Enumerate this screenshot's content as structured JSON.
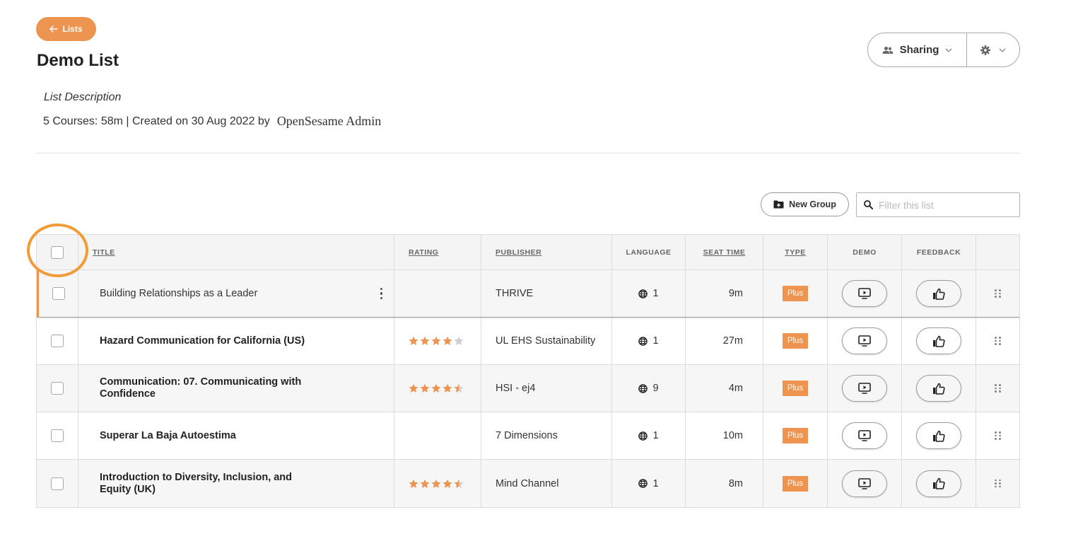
{
  "back_button": {
    "label": "Lists",
    "icon": "arrow-left-icon"
  },
  "page_title": "Demo List",
  "sharing": {
    "label": "Sharing",
    "icon": "people-icon",
    "settings_icon": "gear-icon"
  },
  "description": "List Description",
  "meta": {
    "summary": "5 Courses: 58m | Created on 30 Aug 2022 by",
    "author": "OpenSesame Admin"
  },
  "toolbar": {
    "new_group_label": "New Group",
    "filter_placeholder": "Filter this list",
    "filter_value": ""
  },
  "table": {
    "headers": {
      "title": "TITLE",
      "rating": "RATING",
      "publisher": "PUBLISHER",
      "language": "LANGUAGE",
      "seat_time": "SEAT TIME",
      "type": "TYPE",
      "demo": "DEMO",
      "feedback": "FEEDBACK"
    },
    "rows": [
      {
        "title": "Building Relationships as a Leader",
        "rating": null,
        "publisher": "THRIVE",
        "languages": "1",
        "seat_time": "9m",
        "type": "Plus"
      },
      {
        "title": "Hazard Communication for California (US)",
        "rating": 4,
        "publisher": "UL EHS Sustainability",
        "languages": "1",
        "seat_time": "27m",
        "type": "Plus"
      },
      {
        "title": "Communication: 07. Communicating with Confidence",
        "rating": 4.5,
        "publisher": "HSI - ej4",
        "languages": "9",
        "seat_time": "4m",
        "type": "Plus"
      },
      {
        "title": "Superar La Baja Autoestima",
        "rating": null,
        "publisher": "7 Dimensions",
        "languages": "1",
        "seat_time": "10m",
        "type": "Plus"
      },
      {
        "title": "Introduction to Diversity, Inclusion, and Equity (UK)",
        "rating": 4.5,
        "publisher": "Mind Channel",
        "languages": "1",
        "seat_time": "8m",
        "type": "Plus"
      }
    ]
  },
  "colors": {
    "accent": "#ec9450",
    "star_empty": "#cfcfcf",
    "highlight": "#f29c37"
  }
}
